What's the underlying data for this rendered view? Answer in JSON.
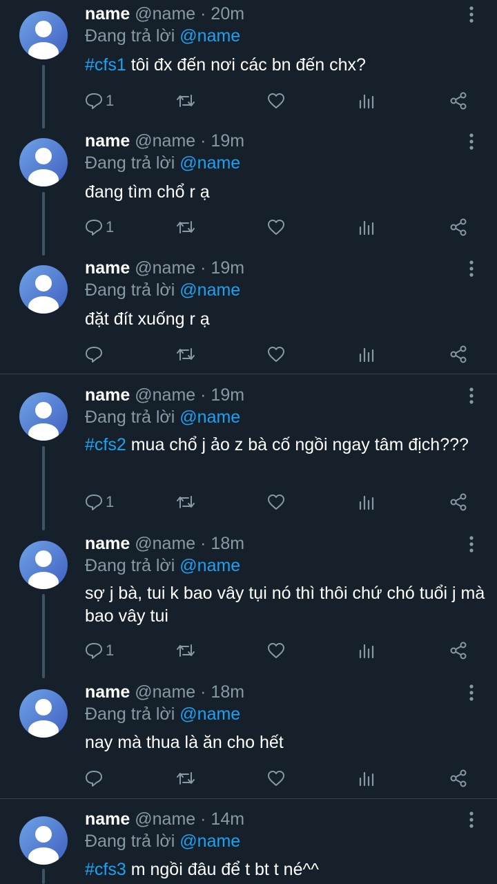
{
  "tweets": [
    {
      "name": "name",
      "handle": "@name",
      "dot": "·",
      "time": "20m",
      "reply_prefix": "Đang trả lời",
      "reply_to": "@name",
      "hashtag": "#cfs1",
      "text": " tôi đx đến nơi các bn đến chx?",
      "reply_count": "1"
    },
    {
      "name": "name",
      "handle": "@name",
      "dot": "·",
      "time": "19m",
      "reply_prefix": "Đang trả lời",
      "reply_to": "@name",
      "hashtag": "",
      "text": "đang tìm chổ r ạ",
      "reply_count": "1"
    },
    {
      "name": "name",
      "handle": "@name",
      "dot": "·",
      "time": "19m",
      "reply_prefix": "Đang trả lời",
      "reply_to": "@name",
      "hashtag": "",
      "text": "đặt đít xuống r ạ",
      "reply_count": ""
    },
    {
      "name": "name",
      "handle": "@name",
      "dot": "·",
      "time": "19m",
      "reply_prefix": "Đang trả lời",
      "reply_to": "@name",
      "hashtag": "#cfs2",
      "text": " mua chổ j ảo z bà cố ngồi ngay tâm địch???",
      "reply_count": "1"
    },
    {
      "name": "name",
      "handle": "@name",
      "dot": "·",
      "time": "18m",
      "reply_prefix": "Đang trả lời",
      "reply_to": "@name",
      "hashtag": "",
      "text": "sợ j bà, tui k bao vây tụi nó thì thôi chứ chó tuổi j mà bao vây tui",
      "reply_count": "1"
    },
    {
      "name": "name",
      "handle": "@name",
      "dot": "·",
      "time": "18m",
      "reply_prefix": "Đang trả lời",
      "reply_to": "@name",
      "hashtag": "",
      "text": "nay mà thua là ăn cho hết",
      "reply_count": ""
    },
    {
      "name": "name",
      "handle": "@name",
      "dot": "·",
      "time": "14m",
      "reply_prefix": "Đang trả lời",
      "reply_to": "@name",
      "hashtag": "#cfs3",
      "text": " m ngồi đâu để t bt t né^^",
      "reply_count": ""
    }
  ],
  "icons": {
    "reply": "reply-icon",
    "retweet": "retweet-icon",
    "like": "like-icon",
    "analytics": "analytics-icon",
    "share": "share-icon",
    "more": "more-options-icon",
    "avatar": "default-avatar"
  },
  "colors": {
    "background": "#15202b",
    "text": "#ffffff",
    "secondary": "#8899a6",
    "accent": "#1da1f2",
    "avatar_gradient_start": "#6fa3e6",
    "avatar_gradient_end": "#3f5fc0",
    "thread_line": "#3d5466",
    "divider": "#38444d"
  }
}
